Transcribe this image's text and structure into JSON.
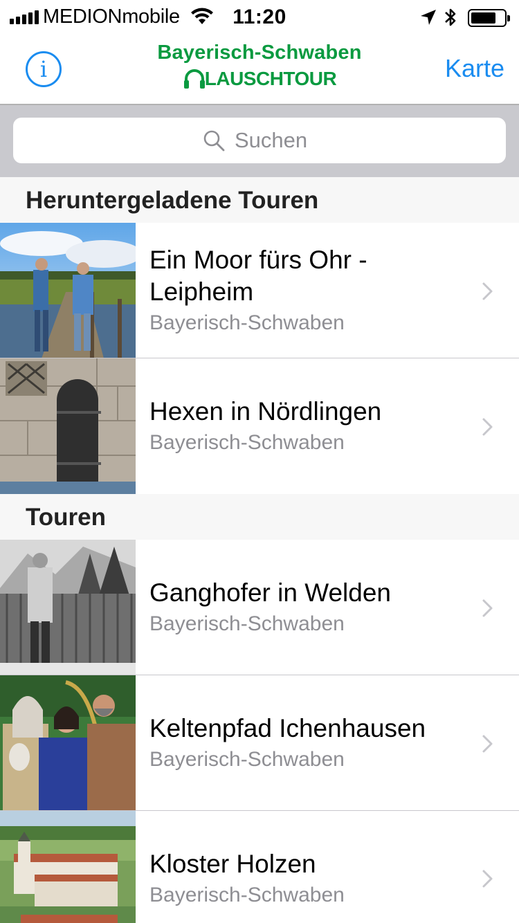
{
  "status_bar": {
    "carrier": "MEDIONmobile",
    "time": "11:20",
    "battery_level": 0.75
  },
  "nav": {
    "info_label": "i",
    "brand_title": "Bayerisch-Schwaben",
    "brand_logo": "LAUSCHTOUR",
    "map_button": "Karte"
  },
  "search": {
    "placeholder": "Suchen"
  },
  "sections": {
    "downloaded": {
      "header": "Heruntergeladene Touren",
      "items": [
        {
          "title": "Ein Moor fürs Ohr - Leipheim",
          "subtitle": "Bayerisch-Schwaben"
        },
        {
          "title": "Hexen in Nördlingen",
          "subtitle": "Bayerisch-Schwaben"
        }
      ]
    },
    "tours": {
      "header": "Touren",
      "items": [
        {
          "title": "Ganghofer in Welden",
          "subtitle": "Bayerisch-Schwaben"
        },
        {
          "title": "Keltenpfad Ichenhausen",
          "subtitle": "Bayerisch-Schwaben"
        },
        {
          "title": "Kloster Holzen",
          "subtitle": "Bayerisch-Schwaben"
        }
      ]
    }
  },
  "colors": {
    "accent": "#1a8cf0",
    "brand": "#0a9a40",
    "search_bg": "#c9c9ce",
    "section_bg": "#f7f7f7",
    "secondary_text": "#8e8e93"
  }
}
